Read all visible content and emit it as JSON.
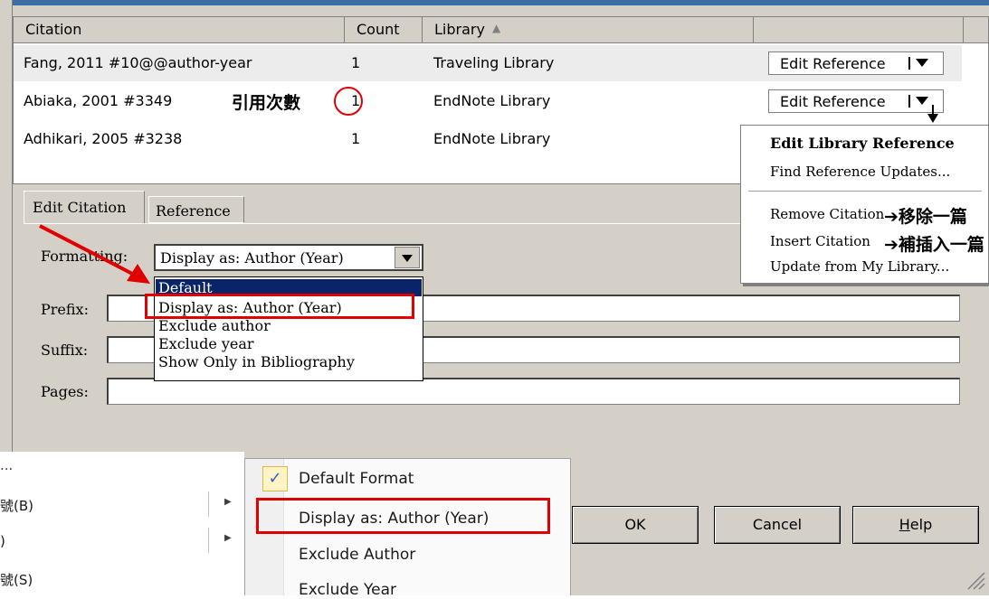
{
  "table": {
    "headers": {
      "citation": "Citation",
      "count": "Count",
      "library": "Library"
    },
    "rows": [
      {
        "citation": "Fang, 2011 #10@@author-year",
        "count": "1",
        "library": "Traveling Library",
        "button": "Edit Reference"
      },
      {
        "citation": "Abiaka, 2001 #3349",
        "count": "1",
        "library": "EndNote Library",
        "button": "Edit Reference"
      },
      {
        "citation": "Adhikari, 2005 #3238",
        "count": "1",
        "library": "EndNote Library"
      }
    ]
  },
  "tabs": {
    "edit_citation": "Edit Citation",
    "reference": "Reference"
  },
  "form": {
    "formatting_label": "Formatting:",
    "formatting_value": "Display as: Author (Year)",
    "prefix_label": "Prefix:",
    "suffix_label": "Suffix:",
    "pages_label": "Pages:",
    "options": [
      "Default",
      "Display as: Author (Year)",
      "Exclude author",
      "Exclude year",
      "Show Only in Bibliography"
    ]
  },
  "context_menu": {
    "items": [
      "Edit Library Reference",
      "Find Reference Updates...",
      "Remove Citation",
      "Insert Citation",
      "Update from My Library..."
    ]
  },
  "buttons": {
    "ok": "OK",
    "cancel": "Cancel",
    "help": "Help"
  },
  "office_menu": {
    "items": [
      "Default Format",
      "Display as: Author (Year)",
      "Exclude Author",
      "Exclude Year"
    ],
    "left_items": [
      "...",
      "號(B)",
      ")",
      "號(S)"
    ]
  },
  "annotations": {
    "count_note": "引用次數",
    "remove_note": "➔移除一篇",
    "insert_note": "➔補插入一篇"
  },
  "colors": {
    "annotation_red": "#e00000",
    "selection_blue": "#0a246a",
    "dialog_gray": "#d4d0c8"
  }
}
